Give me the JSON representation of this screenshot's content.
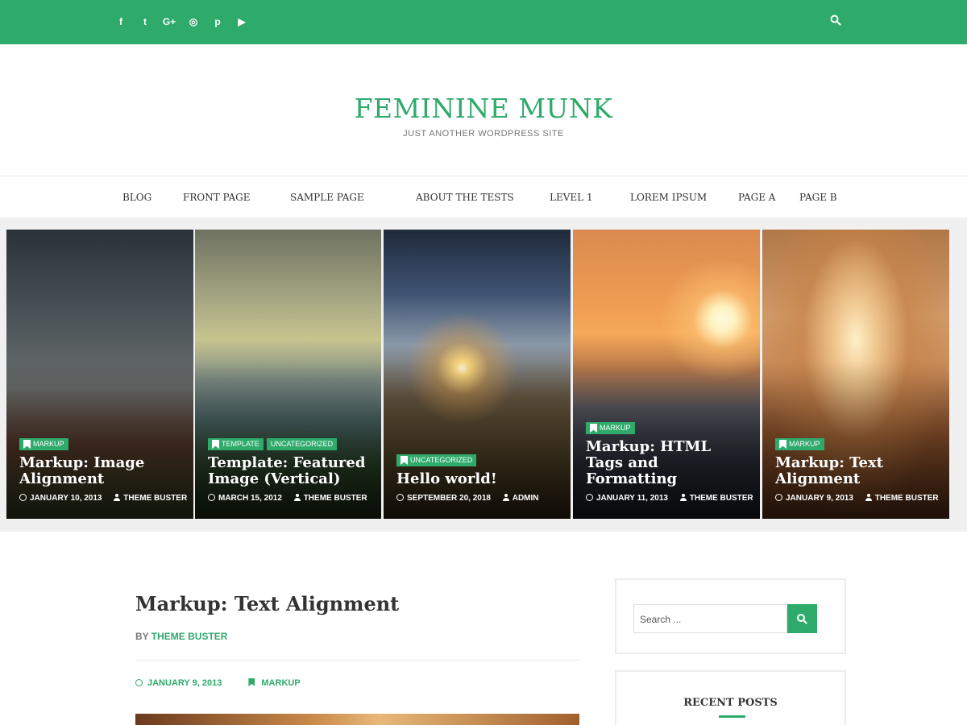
{
  "colors": {
    "accent": "#2eaa6b",
    "text": "#333333"
  },
  "topbar": {
    "social_icons": [
      "facebook-icon",
      "twitter-icon",
      "google-plus-icon",
      "instagram-icon",
      "pinterest-icon",
      "youtube-icon"
    ],
    "social_glyphs": [
      "f",
      "t",
      "G+",
      "◎",
      "p",
      "▶"
    ],
    "search_icon": "search-icon"
  },
  "header": {
    "site_title": "FEMININE MUNK",
    "tagline": "JUST ANOTHER WORDPRESS SITE"
  },
  "nav": {
    "items": [
      "BLOG",
      "FRONT PAGE",
      "SAMPLE PAGE",
      "ABOUT THE TESTS",
      "LEVEL 1",
      "LOREM IPSUM",
      "PAGE A",
      "PAGE B"
    ]
  },
  "slider": {
    "slides": [
      {
        "categories": [
          "MARKUP"
        ],
        "title": "Markup: Image Alignment",
        "date": "JANUARY 10, 2013",
        "author": "THEME BUSTER"
      },
      {
        "categories": [
          "TEMPLATE",
          "UNCATEGORIZED"
        ],
        "title": "Template: Featured Image (Vertical)",
        "date": "MARCH 15, 2012",
        "author": "THEME BUSTER"
      },
      {
        "categories": [
          "UNCATEGORIZED"
        ],
        "title": "Hello world!",
        "date": "SEPTEMBER 20, 2018",
        "author": "ADMIN"
      },
      {
        "categories": [
          "MARKUP"
        ],
        "title": "Markup: HTML Tags and Formatting",
        "date": "JANUARY 11, 2013",
        "author": "THEME BUSTER"
      },
      {
        "categories": [
          "MARKUP"
        ],
        "title": "Markup: Text Alignment",
        "date": "JANUARY 9, 2013",
        "author": "THEME BUSTER"
      }
    ]
  },
  "post": {
    "title": "Markup: Text Alignment",
    "by_label": "BY",
    "author": "THEME BUSTER",
    "date": "JANUARY 9, 2013",
    "category": "MARKUP"
  },
  "sidebar": {
    "search_placeholder": "Search ...",
    "recent_posts_title": "RECENT POSTS"
  }
}
